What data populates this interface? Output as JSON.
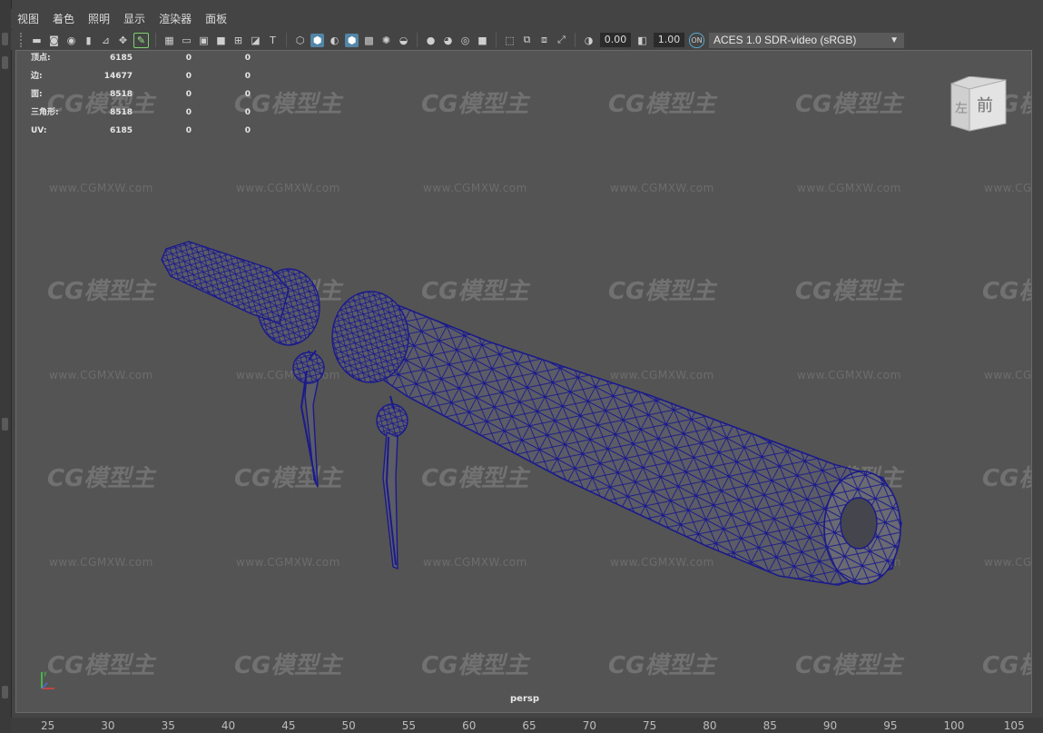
{
  "menus": [
    "视图",
    "着色",
    "照明",
    "显示",
    "渲染器",
    "面板"
  ],
  "toolbar": {
    "exposure": "0.00",
    "gamma": "1.00",
    "color_space": "ACES 1.0 SDR-video (sRGB)"
  },
  "hud": {
    "rows": [
      {
        "label": "顶点:",
        "v1": "6185",
        "v2": "0",
        "v3": "0"
      },
      {
        "label": "边:",
        "v1": "14677",
        "v2": "0",
        "v3": "0"
      },
      {
        "label": "面:",
        "v1": "8518",
        "v2": "0",
        "v3": "0"
      },
      {
        "label": "三角形:",
        "v1": "8518",
        "v2": "0",
        "v3": "0"
      },
      {
        "label": "UV:",
        "v1": "6185",
        "v2": "0",
        "v3": "0"
      }
    ]
  },
  "viewcube": {
    "left_face": "左",
    "front_face": "前"
  },
  "watermark": {
    "logo": "CG模型主",
    "url": "www.CGMXW.com"
  },
  "camera_label": "persp",
  "timeline_ticks": [
    "25",
    "30",
    "35",
    "40",
    "45",
    "50",
    "55",
    "60",
    "65",
    "70",
    "75",
    "80",
    "85",
    "90",
    "95",
    "100",
    "105"
  ],
  "colors": {
    "wireframe": "#1a1a8c",
    "mesh_fill": "#5c5c66",
    "viewport_bg": "#545454"
  }
}
